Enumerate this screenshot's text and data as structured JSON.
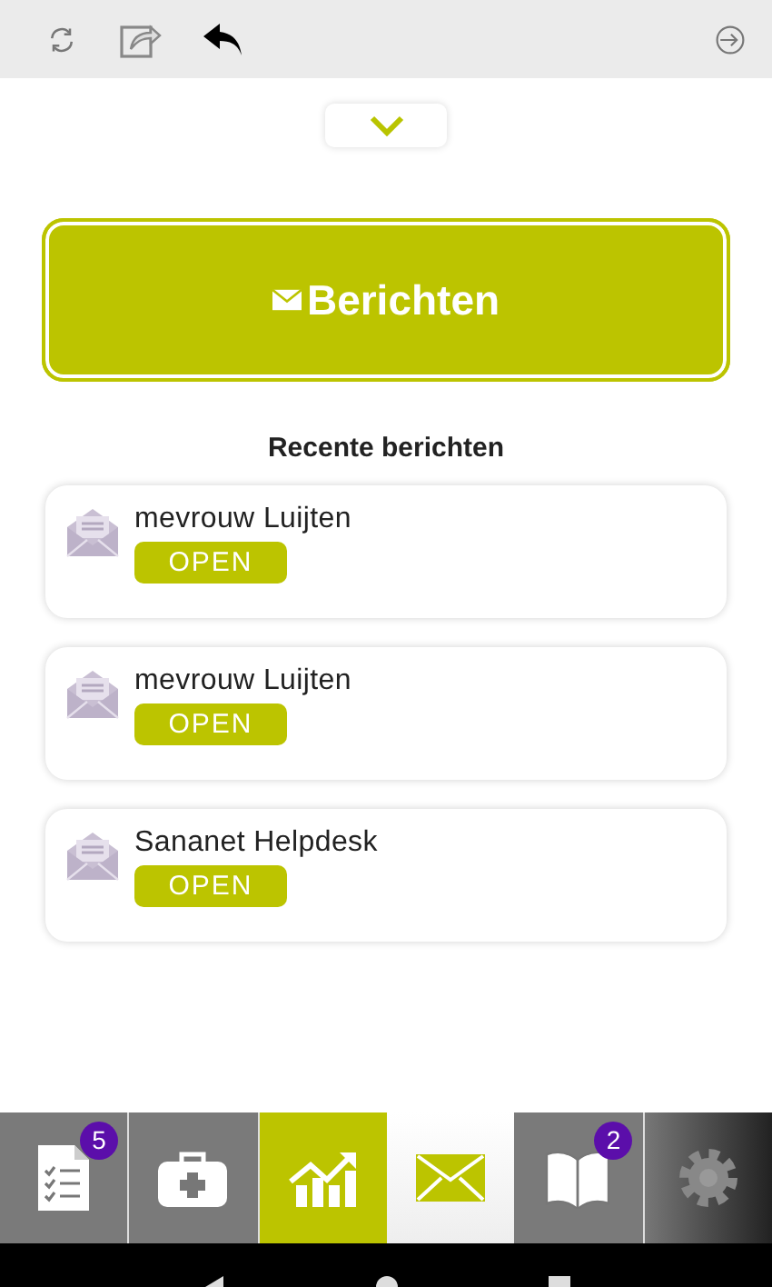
{
  "header_button": {
    "label": "Berichten"
  },
  "section_title": "Recente berichten",
  "messages": [
    {
      "sender": "mevrouw Luijten",
      "action": "OPEN"
    },
    {
      "sender": "mevrouw Luijten",
      "action": "OPEN"
    },
    {
      "sender": "Sananet Helpdesk",
      "action": "OPEN"
    }
  ],
  "tabs": [
    {
      "kind": "checklist",
      "badge": "5",
      "selected": false,
      "accent": false
    },
    {
      "kind": "medkit",
      "selected": false,
      "accent": false
    },
    {
      "kind": "chart",
      "selected": false,
      "accent": true
    },
    {
      "kind": "mail",
      "selected": true,
      "accent": false
    },
    {
      "kind": "book",
      "badge": "2",
      "selected": false,
      "accent": false
    },
    {
      "kind": "gear",
      "selected": false,
      "accent": false
    }
  ]
}
